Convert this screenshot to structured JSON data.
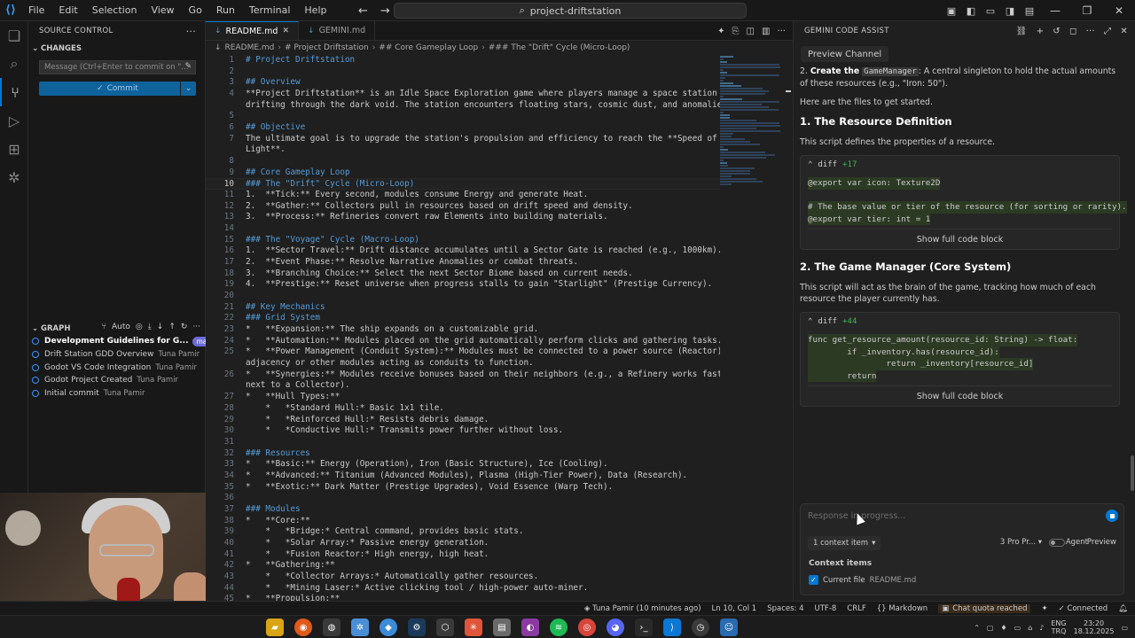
{
  "titlebar": {
    "menu": [
      "File",
      "Edit",
      "Selection",
      "View",
      "Go",
      "Run",
      "Terminal",
      "Help"
    ],
    "search": "project-driftstation"
  },
  "sidebar": {
    "title": "SOURCE CONTROL",
    "changes_label": "CHANGES",
    "commit_placeholder": "Message (Ctrl+Enter to commit on \"...",
    "commit_button": "Commit",
    "graph_label": "GRAPH",
    "graph_auto": "Auto",
    "commits": [
      {
        "message": "Development Guidelines for G...",
        "author": "",
        "branch": "main",
        "head": true
      },
      {
        "message": "Drift Station GDD Overview",
        "author": "Tuna Pamir",
        "branch": "",
        "head": false
      },
      {
        "message": "Godot VS Code Integration",
        "author": "Tuna Pamir",
        "branch": "",
        "head": false
      },
      {
        "message": "Godot Project Created",
        "author": "Tuna Pamir",
        "branch": "",
        "head": false
      },
      {
        "message": "Initial commit",
        "author": "Tuna Pamir",
        "branch": "",
        "head": false
      }
    ]
  },
  "editor": {
    "tabs": [
      {
        "label": "README.md",
        "active": true
      },
      {
        "label": "GEMINI.md",
        "active": false
      }
    ],
    "breadcrumb": [
      "README.md",
      "# Project Driftstation",
      "## Core Gameplay Loop",
      "### The \"Drift\" Cycle (Micro-Loop)"
    ],
    "current_line": 10,
    "lines": [
      {
        "n": "1",
        "t": "# Project Driftstation",
        "k": "h"
      },
      {
        "n": "2",
        "t": "",
        "k": ""
      },
      {
        "n": "3",
        "t": "## Overview",
        "k": "h"
      },
      {
        "n": "4",
        "t": "**Project Driftstation** is an Idle Space Exploration game where players manage a space station",
        "k": "mix"
      },
      {
        "n": "",
        "t": "drifting through the dark void. The station encounters floating stars, cosmic dust, and anomalies.",
        "k": ""
      },
      {
        "n": "5",
        "t": "",
        "k": ""
      },
      {
        "n": "6",
        "t": "## Objective",
        "k": "h"
      },
      {
        "n": "7",
        "t": "The ultimate goal is to upgrade the station's propulsion and efficiency to reach the **Speed of",
        "k": ""
      },
      {
        "n": "",
        "t": "Light**.",
        "k": ""
      },
      {
        "n": "8",
        "t": "",
        "k": ""
      },
      {
        "n": "9",
        "t": "## Core Gameplay Loop",
        "k": "h"
      },
      {
        "n": "10",
        "t": "### The \"Drift\" Cycle (Micro-Loop)",
        "k": "h"
      },
      {
        "n": "11",
        "t": "1.  **Tick:** Every second, modules consume Energy and generate Heat.",
        "k": ""
      },
      {
        "n": "12",
        "t": "2.  **Gather:** Collectors pull in resources based on drift speed and density.",
        "k": ""
      },
      {
        "n": "13",
        "t": "3.  **Process:** Refineries convert raw Elements into building materials.",
        "k": ""
      },
      {
        "n": "14",
        "t": "",
        "k": ""
      },
      {
        "n": "15",
        "t": "### The \"Voyage\" Cycle (Macro-Loop)",
        "k": "h"
      },
      {
        "n": "16",
        "t": "1.  **Sector Travel:** Drift distance accumulates until a Sector Gate is reached (e.g., 1000km).",
        "k": ""
      },
      {
        "n": "17",
        "t": "2.  **Event Phase:** Resolve Narrative Anomalies or combat threats.",
        "k": ""
      },
      {
        "n": "18",
        "t": "3.  **Branching Choice:** Select the next Sector Biome based on current needs.",
        "k": ""
      },
      {
        "n": "19",
        "t": "4.  **Prestige:** Reset universe when progress stalls to gain \"Starlight\" (Prestige Currency).",
        "k": ""
      },
      {
        "n": "20",
        "t": "",
        "k": ""
      },
      {
        "n": "21",
        "t": "## Key Mechanics",
        "k": "h"
      },
      {
        "n": "22",
        "t": "### Grid System",
        "k": "h"
      },
      {
        "n": "23",
        "t": "*   **Expansion:** The ship expands on a customizable grid.",
        "k": ""
      },
      {
        "n": "24",
        "t": "*   **Automation:** Modules placed on the grid automatically perform clicks and gathering tasks.",
        "k": ""
      },
      {
        "n": "25",
        "t": "*   **Power Management (Conduit System):** Modules must be connected to a power source (Reactor) via",
        "k": ""
      },
      {
        "n": "",
        "t": "adjacency or other modules acting as conduits to function.",
        "k": ""
      },
      {
        "n": "26",
        "t": "*   **Synergies:** Modules receive bonuses based on their neighbors (e.g., a Refinery works faster",
        "k": ""
      },
      {
        "n": "",
        "t": "next to a Collector).",
        "k": ""
      },
      {
        "n": "27",
        "t": "*   **Hull Types:**",
        "k": ""
      },
      {
        "n": "28",
        "t": "    *   *Standard Hull:* Basic 1x1 tile.",
        "k": ""
      },
      {
        "n": "29",
        "t": "    *   *Reinforced Hull:* Resists debris damage.",
        "k": ""
      },
      {
        "n": "30",
        "t": "    *   *Conductive Hull:* Transmits power further without loss.",
        "k": ""
      },
      {
        "n": "31",
        "t": "",
        "k": ""
      },
      {
        "n": "32",
        "t": "### Resources",
        "k": "h"
      },
      {
        "n": "33",
        "t": "*   **Basic:** Energy (Operation), Iron (Basic Structure), Ice (Cooling).",
        "k": ""
      },
      {
        "n": "34",
        "t": "*   **Advanced:** Titanium (Advanced Modules), Plasma (High-Tier Power), Data (Research).",
        "k": ""
      },
      {
        "n": "35",
        "t": "*   **Exotic:** Dark Matter (Prestige Upgrades), Void Essence (Warp Tech).",
        "k": ""
      },
      {
        "n": "36",
        "t": "",
        "k": ""
      },
      {
        "n": "37",
        "t": "### Modules",
        "k": "h"
      },
      {
        "n": "38",
        "t": "*   **Core:**",
        "k": ""
      },
      {
        "n": "39",
        "t": "    *   *Bridge:* Central command, provides basic stats.",
        "k": ""
      },
      {
        "n": "40",
        "t": "    *   *Solar Array:* Passive energy generation.",
        "k": ""
      },
      {
        "n": "41",
        "t": "    *   *Fusion Reactor:* High energy, high heat.",
        "k": ""
      },
      {
        "n": "42",
        "t": "*   **Gathering:**",
        "k": ""
      },
      {
        "n": "43",
        "t": "    *   *Collector Arrays:* Automatically gather resources.",
        "k": ""
      },
      {
        "n": "44",
        "t": "    *   *Mining Laser:* Active clicking tool / high-power auto-miner.",
        "k": ""
      },
      {
        "n": "45",
        "t": "*   **Propulsion:**",
        "k": ""
      }
    ]
  },
  "gemini": {
    "title": "GEMINI CODE ASSIST",
    "preview_channel": "Preview Channel",
    "intro_item_num": "2.",
    "intro_item_bold": "Create the",
    "intro_item_code": "GameManager",
    "intro_item_rest": ": A central singleton to hold the actual amounts of these resources (e.g., \"Iron: 50\").",
    "files_intro": "Here are the files to get started.",
    "section1_title": "1. The Resource Definition",
    "section1_desc": "This script defines the properties of a resource.",
    "block1_label": "diff",
    "block1_adds": "+17",
    "block1_code": [
      "@export var icon: Texture2D",
      "",
      "# The base value or tier of the resource (for sorting or rarity).",
      "@export var tier: int = 1"
    ],
    "show_full": "Show full code block",
    "section2_title": "2. The Game Manager (Core System)",
    "section2_desc": "This script will act as the brain of the game, tracking how much of each resource the player currently has.",
    "block2_label": "diff",
    "block2_adds": "+44",
    "block2_code": [
      "func get_resource_amount(resource_id: String) -> float:",
      "        if _inventory.has(resource_id):",
      "                return _inventory[resource_id]",
      "        return"
    ],
    "input_placeholder": "Response in progress...",
    "context_button": "1 context item",
    "model_label": "3 Pro Pr...",
    "agent_label": "Agent",
    "preview_label": "Preview",
    "context_items_title": "Context items",
    "current_file_label": "Current file",
    "current_file_name": "README.md"
  },
  "statusbar": {
    "blame": "Tuna Pamir (10 minutes ago)",
    "position": "Ln 10, Col 1",
    "spaces": "Spaces: 4",
    "encoding": "UTF-8",
    "eol": "CRLF",
    "language": "Markdown",
    "quota": "Chat quota reached",
    "connection": "Connected"
  },
  "taskbar": {
    "lang_top": "ENG",
    "lang_bottom": "TRQ",
    "time": "23:20",
    "date": "18.12.2025"
  },
  "colors": {
    "accent": "#0078d4",
    "heading": "#569cd6",
    "diff_add": "#3fb950",
    "badge": "#6b6bd6"
  }
}
